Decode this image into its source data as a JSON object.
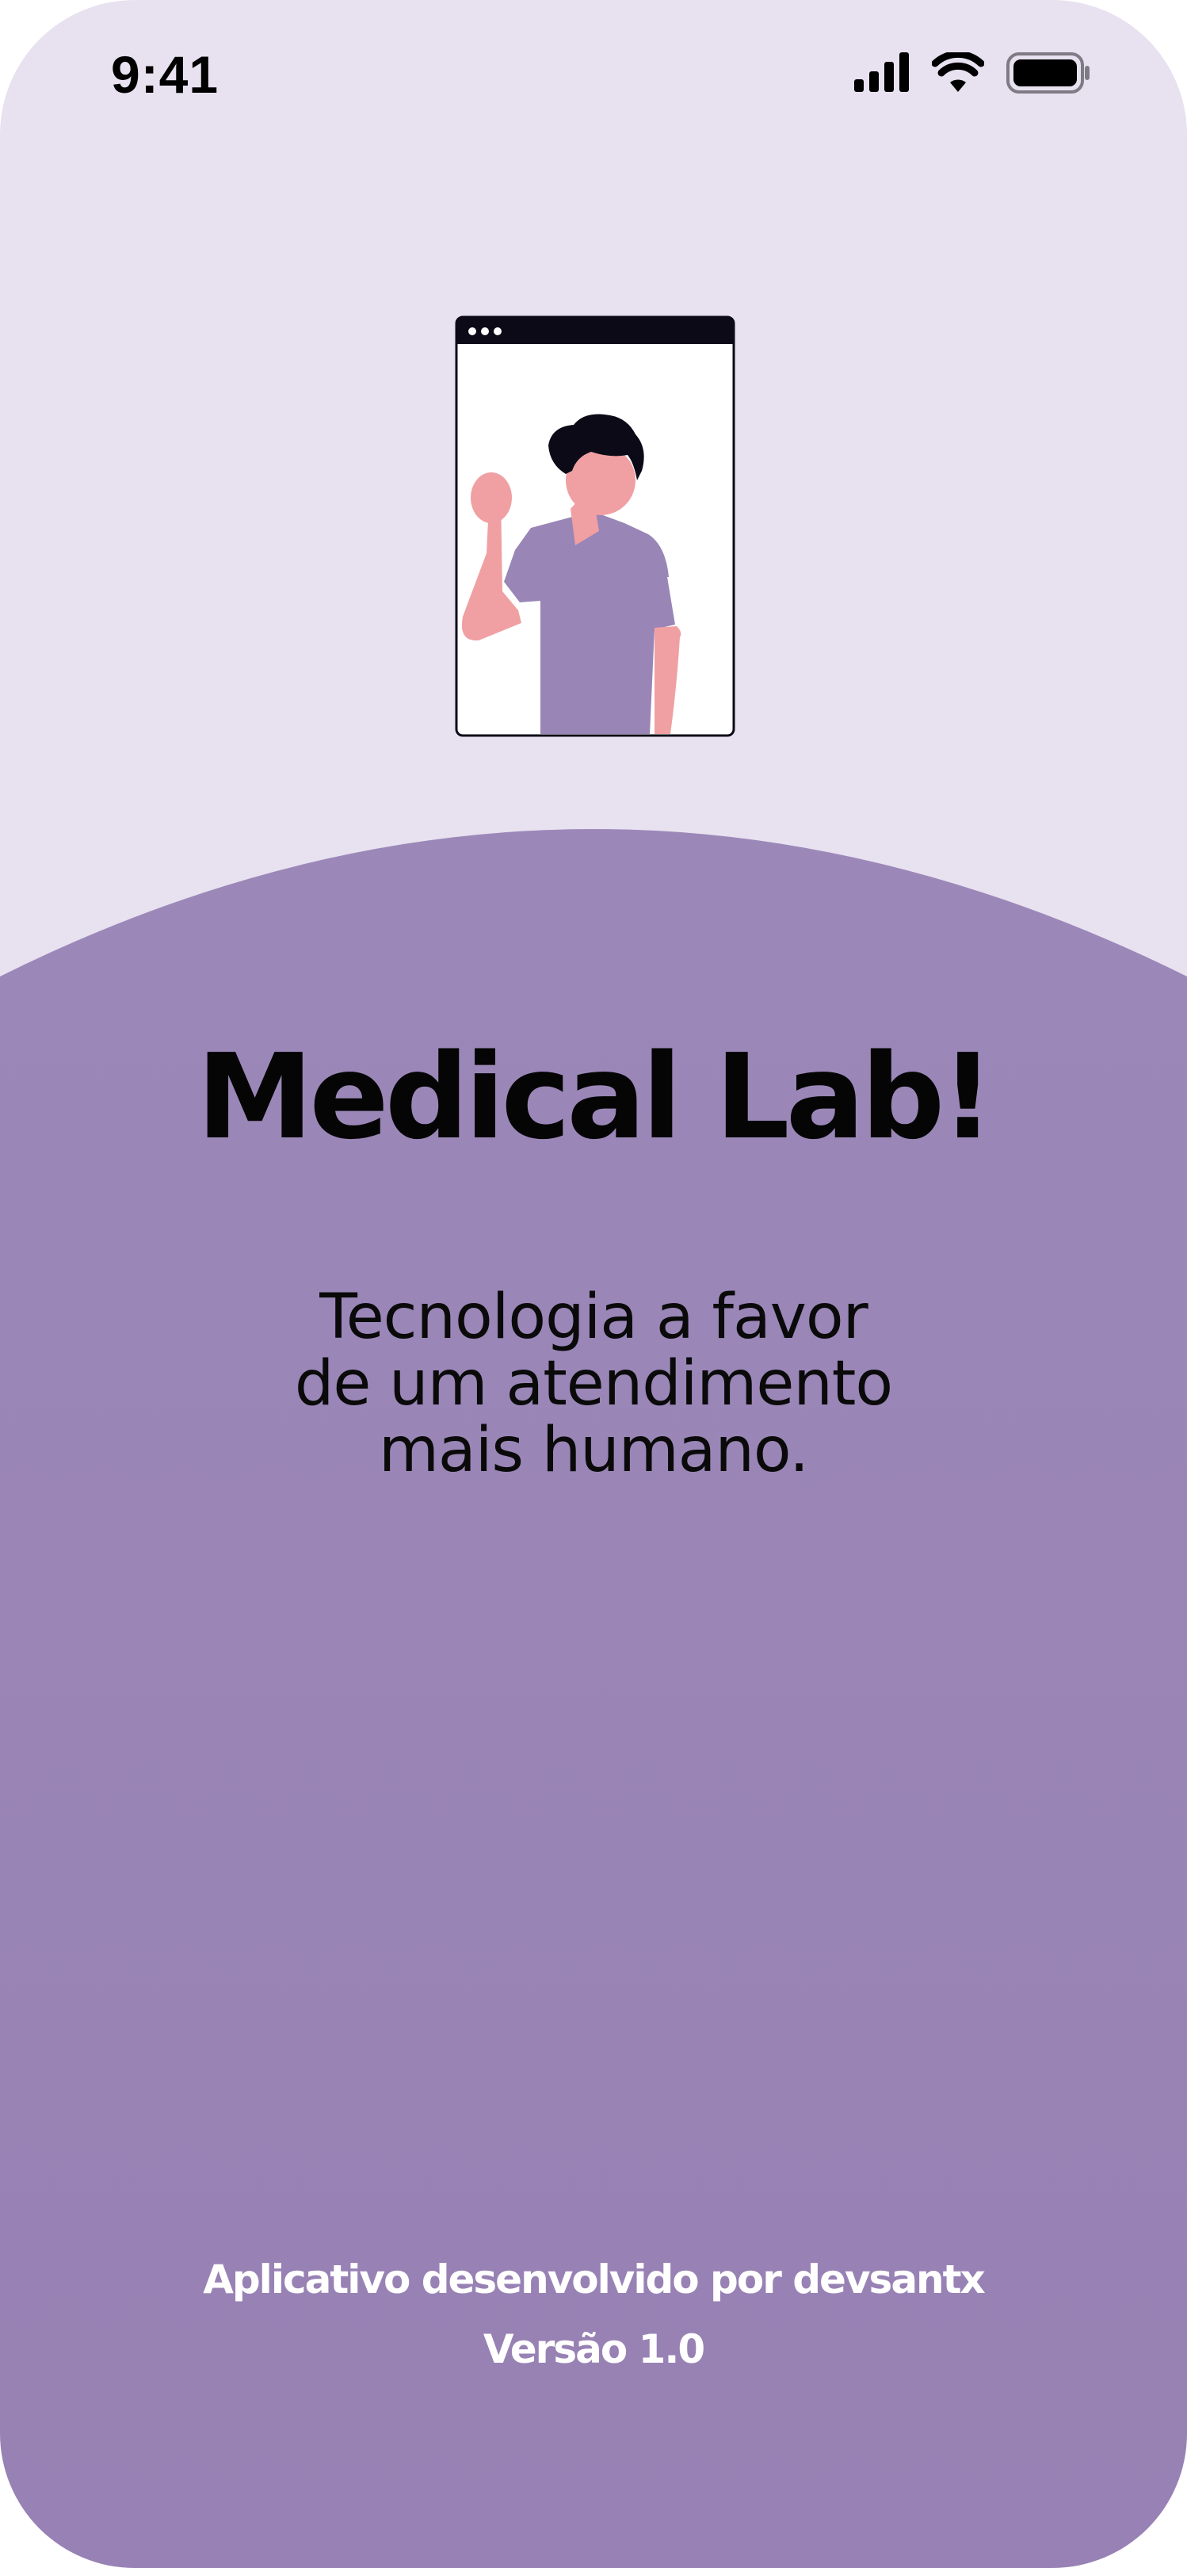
{
  "status_bar": {
    "time": "9:41",
    "icons": [
      "cellular-signal-icon",
      "wifi-icon",
      "battery-icon"
    ]
  },
  "illustration": {
    "name": "person-waving-video-window-illustration"
  },
  "splash": {
    "title": "Medical Lab!",
    "tagline_lines": [
      "Tecnologia a favor",
      "de um atendimento",
      "mais humano."
    ]
  },
  "footer": {
    "credit": "Aplicativo desenvolvido por devsantx",
    "version": "Versão 1.0"
  },
  "colors": {
    "top_background": "#e8e1f0",
    "purple_background": "#9985b6",
    "title_text": "#050505",
    "footer_text": "#ffffff",
    "skin": "#f0a0a2",
    "hair": "#0c0a17"
  }
}
